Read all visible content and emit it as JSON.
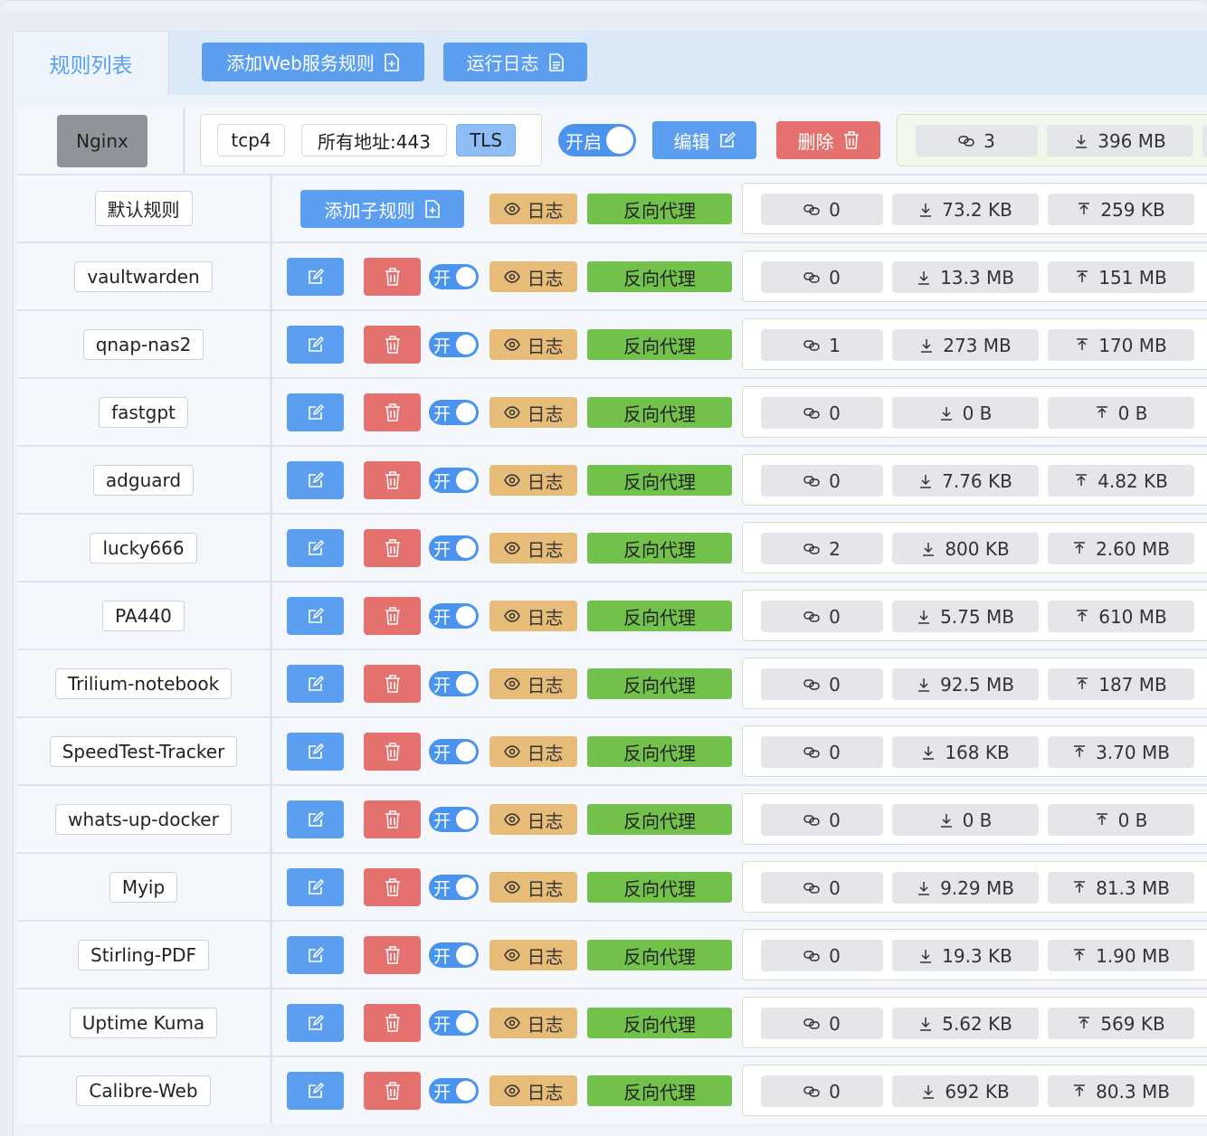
{
  "tabs": {
    "active_label": "规则列表",
    "add_web_rule_label": "添加Web服务规则",
    "run_log_label": "运行日志"
  },
  "main_rule": {
    "name": "Nginx",
    "network": "tcp4",
    "address": "所有地址:443",
    "tls": "TLS",
    "toggle_label": "开启",
    "edit_label": "编辑",
    "delete_label": "删除",
    "connections": "3",
    "download": "396 MB"
  },
  "default_rule": {
    "name": "默认规则",
    "add_sub_label": "添加子规则",
    "log_label": "日志",
    "type_label": "反向代理",
    "connections": "0",
    "download": "73.2 KB",
    "upload": "259 KB"
  },
  "sub_rules": [
    {
      "name": "vaultwarden",
      "toggle": "开",
      "log": "日志",
      "type": "反向代理",
      "connections": "0",
      "download": "13.3 MB",
      "upload": "151 MB"
    },
    {
      "name": "qnap-nas2",
      "toggle": "开",
      "log": "日志",
      "type": "反向代理",
      "connections": "1",
      "download": "273 MB",
      "upload": "170 MB"
    },
    {
      "name": "fastgpt",
      "toggle": "开",
      "log": "日志",
      "type": "反向代理",
      "connections": "0",
      "download": "0 B",
      "upload": "0 B"
    },
    {
      "name": "adguard",
      "toggle": "开",
      "log": "日志",
      "type": "反向代理",
      "connections": "0",
      "download": "7.76 KB",
      "upload": "4.82 KB"
    },
    {
      "name": "lucky666",
      "toggle": "开",
      "log": "日志",
      "type": "反向代理",
      "connections": "2",
      "download": "800 KB",
      "upload": "2.60 MB"
    },
    {
      "name": "PA440",
      "toggle": "开",
      "log": "日志",
      "type": "反向代理",
      "connections": "0",
      "download": "5.75 MB",
      "upload": "610 MB"
    },
    {
      "name": "Trilium-notebook",
      "toggle": "开",
      "log": "日志",
      "type": "反向代理",
      "connections": "0",
      "download": "92.5 MB",
      "upload": "187 MB"
    },
    {
      "name": "SpeedTest-Tracker",
      "toggle": "开",
      "log": "日志",
      "type": "反向代理",
      "connections": "0",
      "download": "168 KB",
      "upload": "3.70 MB"
    },
    {
      "name": "whats-up-docker",
      "toggle": "开",
      "log": "日志",
      "type": "反向代理",
      "connections": "0",
      "download": "0 B",
      "upload": "0 B"
    },
    {
      "name": "Myip",
      "toggle": "开",
      "log": "日志",
      "type": "反向代理",
      "connections": "0",
      "download": "9.29 MB",
      "upload": "81.3 MB"
    },
    {
      "name": "Stirling-PDF",
      "toggle": "开",
      "log": "日志",
      "type": "反向代理",
      "connections": "0",
      "download": "19.3 KB",
      "upload": "1.90 MB"
    },
    {
      "name": "Uptime Kuma",
      "toggle": "开",
      "log": "日志",
      "type": "反向代理",
      "connections": "0",
      "download": "5.62 KB",
      "upload": "569 KB"
    },
    {
      "name": "Calibre-Web",
      "toggle": "开",
      "log": "日志",
      "type": "反向代理",
      "connections": "0",
      "download": "692 KB",
      "upload": "80.3 MB"
    }
  ],
  "colors": {
    "primary": "#5c9ef0",
    "danger": "#e5716e",
    "warning": "#e6bc78",
    "success": "#72c14a",
    "info": "#909399"
  },
  "icons": {
    "add_doc": "document-add-icon",
    "doc": "document-icon",
    "edit": "edit-icon",
    "delete": "trash-icon",
    "eye": "eye-icon",
    "link": "link-icon",
    "download": "download-icon",
    "upload": "upload-icon"
  }
}
